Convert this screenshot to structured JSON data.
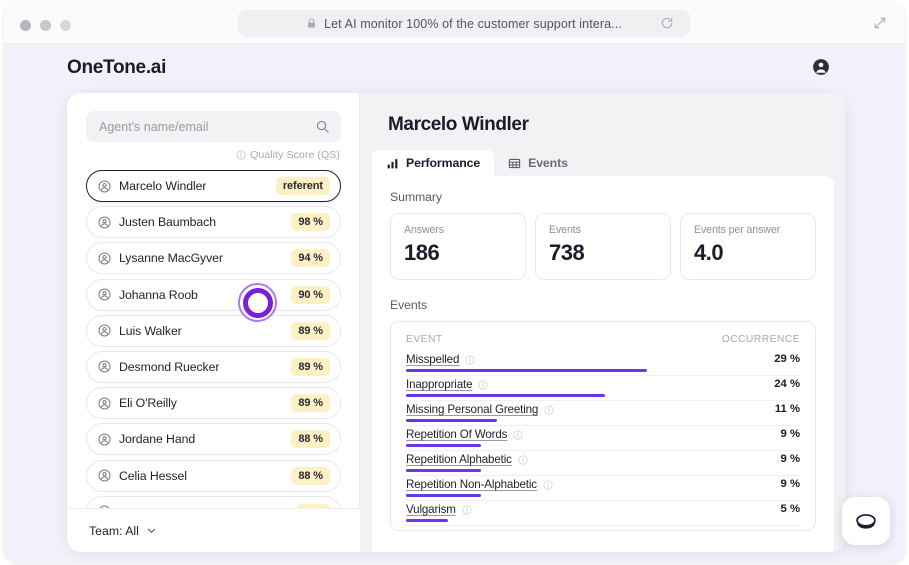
{
  "browser": {
    "url_text": "Let AI monitor 100% of the customer support intera...",
    "lock_icon": "lock-icon",
    "reload_icon": "reload-icon",
    "expand_icon": "expand-icon"
  },
  "header": {
    "brand": "OneTone.ai",
    "account_icon": "account-circle-icon"
  },
  "sidebar": {
    "search_placeholder": "Agent's name/email",
    "search_value": "",
    "search_icon": "search-icon",
    "quality_score_label": "Quality Score (QS)",
    "info_icon": "info-icon",
    "agents": [
      {
        "name": "Marcelo Windler",
        "badge": "referent",
        "selected": true
      },
      {
        "name": "Justen Baumbach",
        "badge": "98 %",
        "selected": false
      },
      {
        "name": "Lysanne MacGyver",
        "badge": "94 %",
        "selected": false
      },
      {
        "name": "Johanna Roob",
        "badge": "90 %",
        "selected": false
      },
      {
        "name": "Luis Walker",
        "badge": "89 %",
        "selected": false
      },
      {
        "name": "Desmond Ruecker",
        "badge": "89 %",
        "selected": false
      },
      {
        "name": "Eli O'Reilly",
        "badge": "89 %",
        "selected": false
      },
      {
        "name": "Jordane Hand",
        "badge": "88 %",
        "selected": false
      },
      {
        "name": "Celia Hessel",
        "badge": "88 %",
        "selected": false
      },
      {
        "name": "",
        "badge": "",
        "selected": false
      }
    ],
    "team_filter": "Team: All",
    "chevron_icon": "chevron-down-icon"
  },
  "detail": {
    "agent_name": "Marcelo Windler",
    "tabs": [
      {
        "label": "Performance",
        "icon": "bar-chart-icon",
        "active": true
      },
      {
        "label": "Events",
        "icon": "table-grid-icon",
        "active": false
      }
    ],
    "summary_label": "Summary",
    "stats": [
      {
        "label": "Answers",
        "value": "186"
      },
      {
        "label": "Events",
        "value": "738"
      },
      {
        "label": "Events per answer",
        "value": "4.0"
      }
    ],
    "events_label": "Events",
    "events_columns": {
      "event": "EVENT",
      "occurrence": "OCCURRENCE"
    },
    "events": [
      {
        "name": "Misspelled",
        "occurrence": "29 %",
        "pct": 29
      },
      {
        "name": "Inappropriate",
        "occurrence": "24 %",
        "pct": 24
      },
      {
        "name": "Missing Personal Greeting",
        "occurrence": "11 %",
        "pct": 11
      },
      {
        "name": "Repetition Of Words",
        "occurrence": "9 %",
        "pct": 9
      },
      {
        "name": "Repetition Alphabetic",
        "occurrence": "9 %",
        "pct": 9
      },
      {
        "name": "Repetition Non-Alphabetic",
        "occurrence": "9 %",
        "pct": 9
      },
      {
        "name": "Vulgarism",
        "occurrence": "5 %",
        "pct": 5
      }
    ]
  },
  "overlays": {
    "click_indicator": "click-ring",
    "chat_fab_icon": "chat-bubble-icon"
  },
  "colors": {
    "accent_purple": "#6b35e8",
    "click_ring": "#7a1fd6",
    "badge_yellow": "#fdf1c4",
    "app_bg": "#f2f0fa"
  },
  "chart_data": {
    "type": "bar",
    "title": "Events",
    "xlabel": "EVENT",
    "ylabel": "OCCURRENCE",
    "categories": [
      "Misspelled",
      "Inappropriate",
      "Missing Personal Greeting",
      "Repetition Of Words",
      "Repetition Alphabetic",
      "Repetition Non-Alphabetic",
      "Vulgarism"
    ],
    "values": [
      29,
      24,
      11,
      9,
      9,
      9,
      5
    ],
    "unit": "%",
    "ylim": [
      0,
      100
    ],
    "grid": false,
    "legend": "none"
  }
}
